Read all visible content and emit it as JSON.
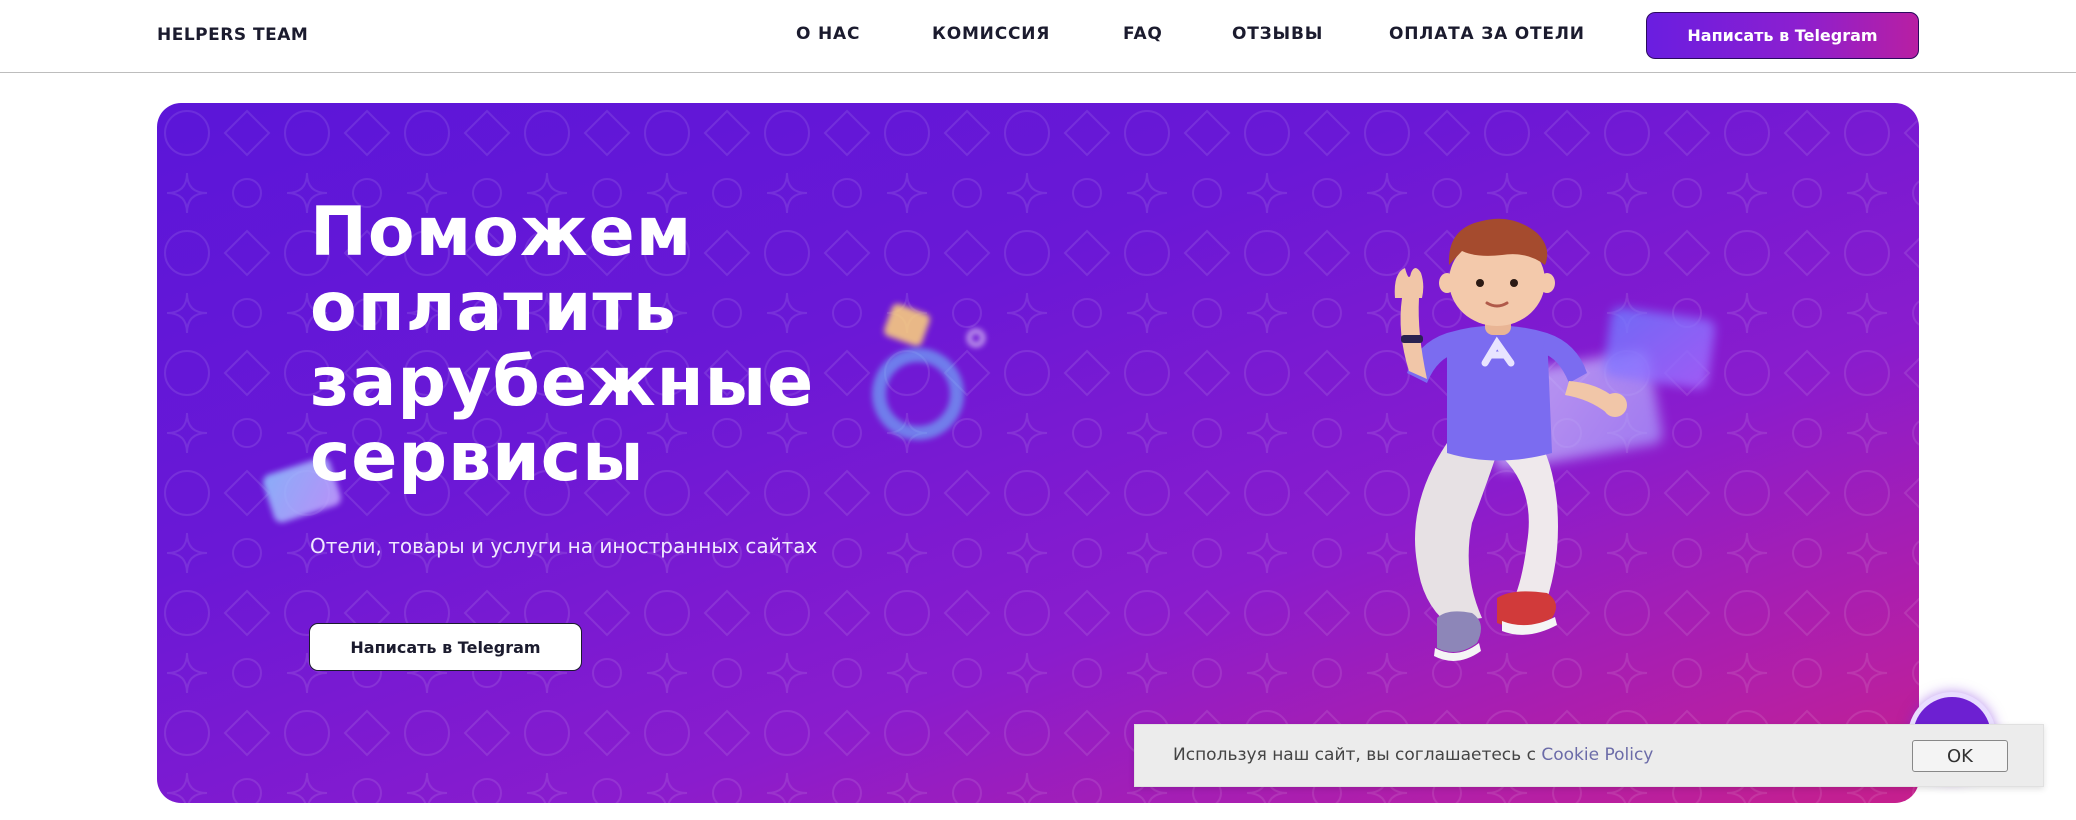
{
  "header": {
    "logo": "HELPERS TEAM",
    "nav": [
      "О НАС",
      "КОМИССИЯ",
      "FAQ",
      "ОТЗЫВЫ",
      "ОПЛАТА ЗА ОТЕЛИ"
    ],
    "cta_label": "Написать в Telegram"
  },
  "hero": {
    "title_lines": [
      "Поможем",
      "оплатить",
      "зарубежные",
      "сервисы"
    ],
    "subtitle": "Отели, товары и услуги на иностранных сайтах",
    "cta_label": "Написать в Telegram"
  },
  "cookie": {
    "text": "Используя наш сайт, вы соглашаетесь с ",
    "link": "Cookie Policy",
    "ok_label": "OK"
  },
  "colors": {
    "accent_start": "#5b16d8",
    "accent_end": "#c61f8c"
  },
  "icons": {
    "floating_button": "telegram-icon"
  }
}
